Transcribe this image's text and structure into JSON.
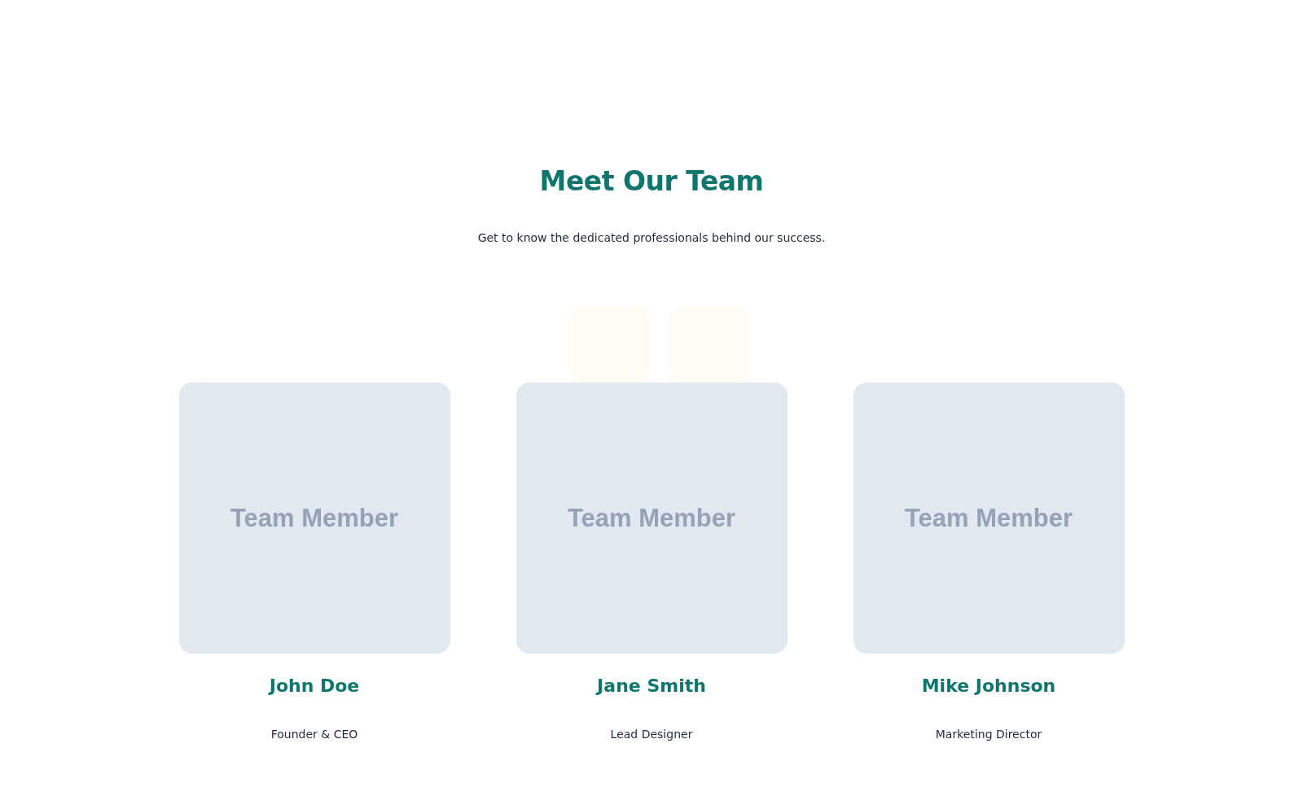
{
  "section": {
    "title": "Meet Our Team",
    "subtitle": "Get to know the dedicated professionals behind our success."
  },
  "members": [
    {
      "photo_label": "Team Member",
      "name": "John Doe",
      "role": "Founder & CEO"
    },
    {
      "photo_label": "Team Member",
      "name": "Jane Smith",
      "role": "Lead Designer"
    },
    {
      "photo_label": "Team Member",
      "name": "Mike Johnson",
      "role": "Marketing Director"
    }
  ]
}
